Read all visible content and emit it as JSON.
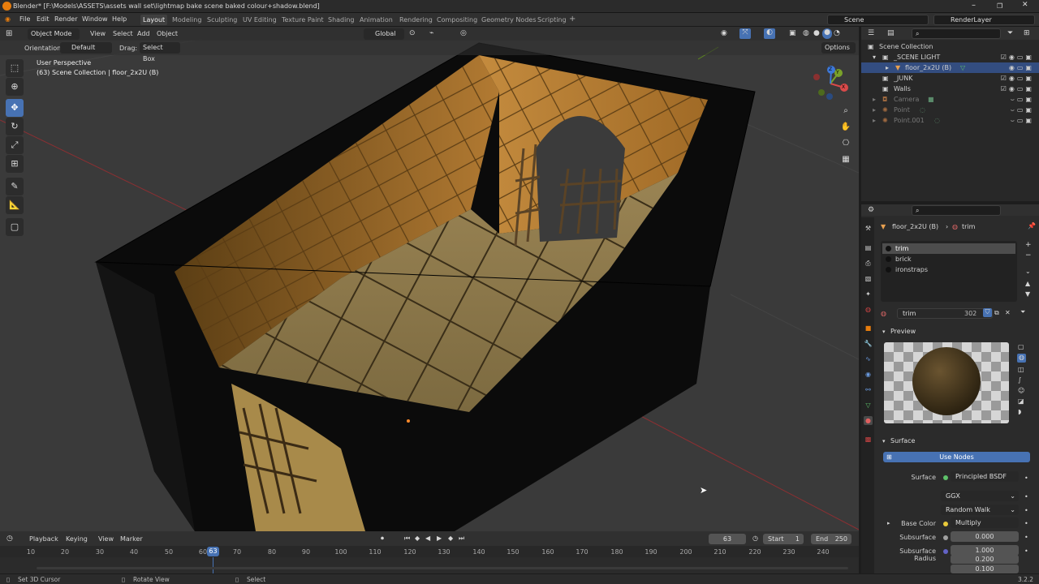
{
  "window": {
    "title": "Blender* [F:\\Models\\ASSETS\\assets wall set\\lightmap bake scene baked colour+shadow.blend]",
    "controls": [
      "–",
      "❐",
      "✕"
    ]
  },
  "menu": [
    "File",
    "Edit",
    "Render",
    "Window",
    "Help"
  ],
  "workspaces": [
    "Layout",
    "Modeling",
    "Sculpting",
    "UV Editing",
    "Texture Paint",
    "Shading",
    "Animation",
    "Rendering",
    "Compositing",
    "Geometry Nodes",
    "Scripting"
  ],
  "active_workspace": "Layout",
  "scene_field": "Scene",
  "view_layer_field": "RenderLayer",
  "viewport": {
    "mode": "Object Mode",
    "menus": [
      "View",
      "Select",
      "Add",
      "Object"
    ],
    "orientation_label": "Orientation:",
    "orientation_value": "Default",
    "drag_label": "Drag:",
    "drag_value": "Select Box",
    "transform_space": "Global",
    "options": "Options",
    "view_name": "User Perspective",
    "view_info": "(63) Scene Collection | floor_2x2U (B)"
  },
  "gizmo_axes": [
    "X",
    "Y",
    "Z"
  ],
  "outliner": {
    "root": "Scene Collection",
    "rows": [
      {
        "label": "_SCENE LIGHT",
        "dim": false
      },
      {
        "label": "floor_2x2U (B)",
        "dim": false
      },
      {
        "label": "_JUNK",
        "dim": false
      },
      {
        "label": "Walls",
        "dim": false
      },
      {
        "label": "Camera",
        "dim": true
      },
      {
        "label": "Point",
        "dim": true
      },
      {
        "label": "Point.001",
        "dim": true
      }
    ]
  },
  "properties": {
    "breadcrumb_object": "floor_2x2U (B)",
    "breadcrumb_material": "trim",
    "material_slots": [
      "trim",
      "brick",
      "ironstraps"
    ],
    "material_name": "trim",
    "material_users": "302",
    "preview_label": "Preview",
    "surface_header": "Surface",
    "use_nodes": "Use Nodes",
    "surface_label": "Surface",
    "surface_value": "Principled BSDF",
    "distribution": "GGX",
    "subsurface_method": "Random Walk",
    "base_color_label": "Base Color",
    "base_color_value": "Multiply",
    "subsurface_label": "Subsurface",
    "subsurface_value": "0.000",
    "subsurface_radius_label": "Subsurface Radius",
    "subsurface_radius_values": [
      "1.000",
      "0.200",
      "0.100"
    ]
  },
  "timeline": {
    "menus": [
      "Playback",
      "Keying",
      "View",
      "Marker"
    ],
    "current_frame": "63",
    "start_label": "Start",
    "start_value": "1",
    "end_label": "End",
    "end_value": "250",
    "ticks": [
      "10",
      "20",
      "30",
      "40",
      "50",
      "60",
      "70",
      "80",
      "90",
      "100",
      "110",
      "120",
      "130",
      "140",
      "150",
      "160",
      "170",
      "180",
      "190",
      "200",
      "210",
      "220",
      "230",
      "240"
    ]
  },
  "statusbar": {
    "left": "Set 3D Cursor",
    "middle": "Rotate View",
    "right": "Select",
    "version": "3.2.2"
  }
}
